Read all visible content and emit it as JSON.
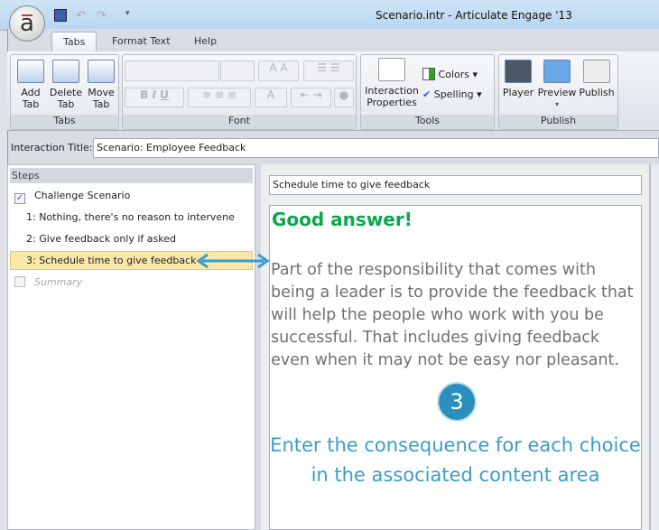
{
  "window": {
    "title": "Scenario.intr -  Articulate Engage '13",
    "logo": "a"
  },
  "ribbon_tabs": [
    "Tabs",
    "Format Text",
    "Help"
  ],
  "groups": {
    "tabs": {
      "label": "Tabs",
      "buttons": [
        "Add\nTab",
        "Delete\nTab",
        "Move\nTab"
      ]
    },
    "font": {
      "label": "Font"
    },
    "tools": {
      "label": "Tools",
      "interaction_properties": "Interaction\nProperties",
      "colors": "Colors",
      "spelling": "Spelling"
    },
    "publish": {
      "label": "Publish",
      "player": "Player",
      "preview": "Preview",
      "publish": "Publish"
    }
  },
  "interaction": {
    "label": "Interaction Title:",
    "value": "Scenario: Employee Feedback"
  },
  "steps": {
    "header": "Steps",
    "items": [
      {
        "label": "Challenge Scenario",
        "checked": true
      },
      {
        "label": "1:  Nothing, there's no reason to intervene"
      },
      {
        "label": "2:  Give feedback only if asked"
      },
      {
        "label": "3:  Schedule time to give feedback",
        "selected": true
      },
      {
        "label": "Summary",
        "checked": false
      }
    ]
  },
  "editor": {
    "response_title": "Schedule time to give feedback",
    "heading": "Good answer!",
    "body": "Part of  the responsibility that comes with being a leader is to provide the feedback that will help the people who work with you be successful. That includes giving feedback even when it may not be easy nor pleasant."
  },
  "callout": {
    "number": "3",
    "text": "Enter the consequence for each choice in the associated content area"
  },
  "colors": {
    "accent": "#2b8fbd",
    "heading": "#0aa74b",
    "selection": "#fbe8a8"
  }
}
